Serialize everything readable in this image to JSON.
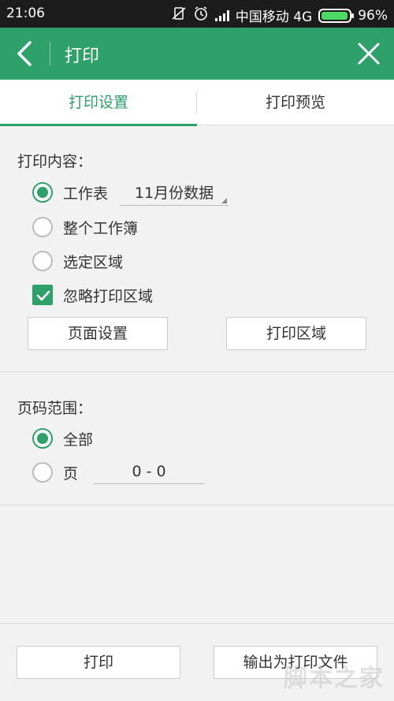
{
  "status": {
    "time": "21:06",
    "carrier": "中国移动 4G",
    "battery_pct": 0.96,
    "battery_text": "96%"
  },
  "appbar": {
    "title": "打印"
  },
  "tabs": [
    {
      "label": "打印设置",
      "active": true
    },
    {
      "label": "打印预览",
      "active": false
    }
  ],
  "content": {
    "title": "打印内容：",
    "options": [
      {
        "label": "工作表",
        "selected": true
      },
      {
        "label": "整个工作簿",
        "selected": false
      },
      {
        "label": "选定区域",
        "selected": false
      }
    ],
    "sheet_select": "11月份数据",
    "ignore_print_area": {
      "label": "忽略打印区域",
      "checked": true
    },
    "page_setup_button": "页面设置",
    "print_area_button": "打印区域"
  },
  "range": {
    "title": "页码范围：",
    "options": [
      {
        "label": "全部",
        "selected": true
      },
      {
        "label": "页",
        "selected": false
      }
    ],
    "pages_value": "0 - 0"
  },
  "footer": {
    "print_button": "打印",
    "export_button": "输出为打印文件"
  },
  "watermark": "脚本之家",
  "colors": {
    "accent": "#2ea06a",
    "statusbar": "#1c1c1c",
    "background": "#f2f2f2"
  },
  "icons": {
    "back": "chevron-left-icon",
    "close": "close-icon",
    "check": "check-icon"
  }
}
